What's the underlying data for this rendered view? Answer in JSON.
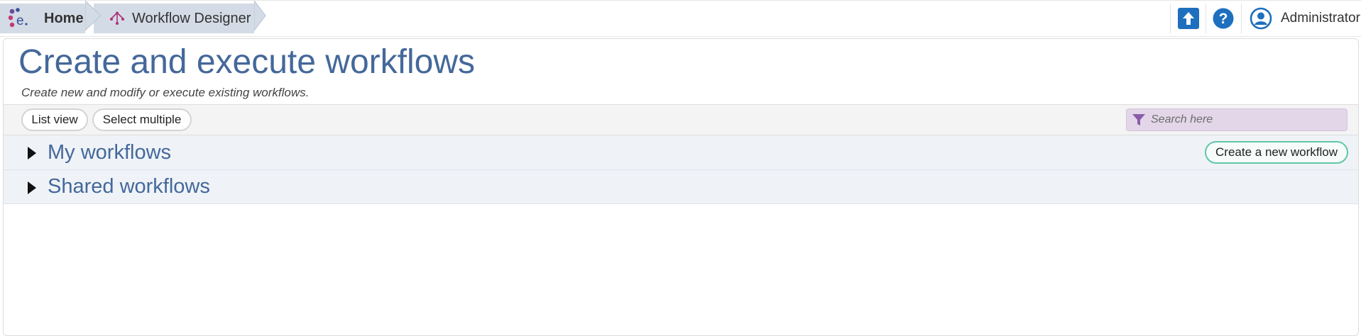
{
  "breadcrumb": {
    "home": "Home",
    "current": "Workflow Designer"
  },
  "user": {
    "name": "Administrator"
  },
  "page": {
    "title": "Create and execute workflows",
    "subtitle": "Create new and modify or execute existing workflows."
  },
  "toolbar": {
    "list_view": "List view",
    "select_multiple": "Select multiple",
    "search_placeholder": "Search here"
  },
  "sections": [
    {
      "label": "My workflows",
      "expanded": false
    },
    {
      "label": "Shared workflows",
      "expanded": false
    }
  ],
  "actions": {
    "create_workflow": "Create a new workflow"
  },
  "icons": {
    "logo": "app-logo-icon",
    "breadcrumb_current": "workflow-icon",
    "upload": "upload-arrow-icon",
    "help": "help-icon",
    "user": "user-avatar-icon",
    "search_filter": "filter-icon",
    "section_toggle": "caret-right-icon"
  },
  "colors": {
    "accent_blue": "#44689a",
    "breadcrumb_bg": "#d3dbe6",
    "icon_blue": "#1e6fbe",
    "search_bg": "#e2d6e8",
    "create_border": "#5fc7a6"
  }
}
